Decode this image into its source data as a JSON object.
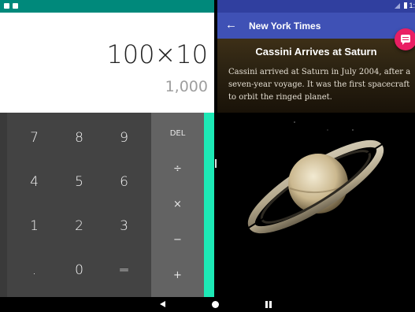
{
  "calculator": {
    "formula": "100×10",
    "result": "1,000",
    "digit_rows": [
      [
        "7",
        "8",
        "9"
      ],
      [
        "4",
        "5",
        "6"
      ],
      [
        "1",
        "2",
        "3"
      ],
      [
        ".",
        "0",
        "="
      ]
    ],
    "operators": [
      "DEL",
      "÷",
      "×",
      "−",
      "+"
    ],
    "colors": {
      "status_bar": "#00897b",
      "numpad": "#434343",
      "operators": "#636363",
      "advanced_strip": "#1de9b6"
    }
  },
  "nyt": {
    "app_title": "New York Times",
    "article": {
      "title": "Cassini Arrives at Saturn",
      "body": "Cassini arrived at Saturn in July 2004, after a seven-year voyage. It was the first spacecraft to orbit the ringed planet."
    },
    "status_right": "1:",
    "icons": {
      "back": "arrow-back-icon",
      "fab": "comment-icon"
    },
    "colors": {
      "app_bar": "#3f51b5",
      "status_bar": "#303f9f",
      "fab": "#e91e63"
    }
  },
  "navigation": {
    "icons": [
      "nav-back-icon",
      "nav-home-icon",
      "nav-split-screen-icon"
    ]
  }
}
